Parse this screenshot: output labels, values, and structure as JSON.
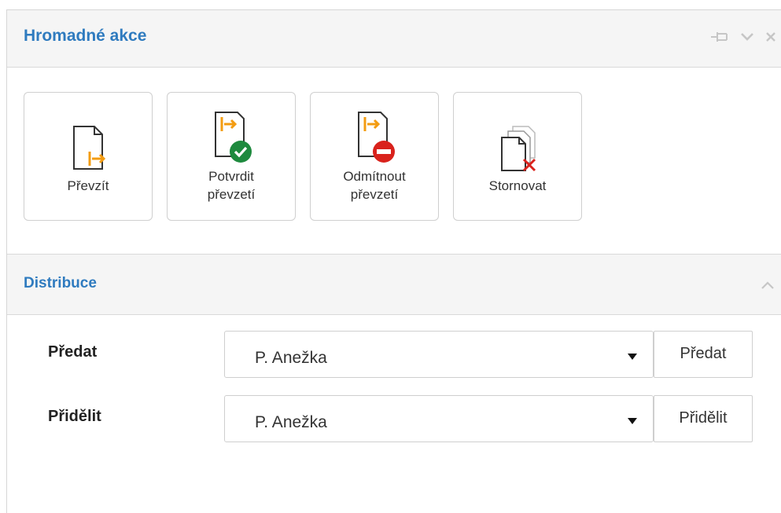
{
  "panel": {
    "title": "Hromadné akce",
    "header_tools": [
      {
        "icon": "pin-icon"
      },
      {
        "icon": "chevron-down-icon"
      },
      {
        "icon": "close-icon"
      }
    ]
  },
  "actions": [
    {
      "label": "Převzít",
      "icon": "document-takeover-icon"
    },
    {
      "label": "Potvrdit\npřevzetí",
      "icon": "document-confirm-icon"
    },
    {
      "label": "Odmítnout\npřevzetí",
      "icon": "document-reject-icon"
    },
    {
      "label": "Stornovat",
      "icon": "documents-cancel-icon"
    }
  ],
  "distribuce": {
    "title": "Distribuce",
    "rows": [
      {
        "label": "Předat",
        "selected": "P. Anežka",
        "button": "Předat"
      },
      {
        "label": "Přidělit",
        "selected": "P. Anežka",
        "button": "Přidělit"
      }
    ]
  },
  "colors": {
    "accent": "#2f7bbf",
    "orange": "#f39c12",
    "green": "#1e8a3e",
    "red": "#d9221c"
  }
}
